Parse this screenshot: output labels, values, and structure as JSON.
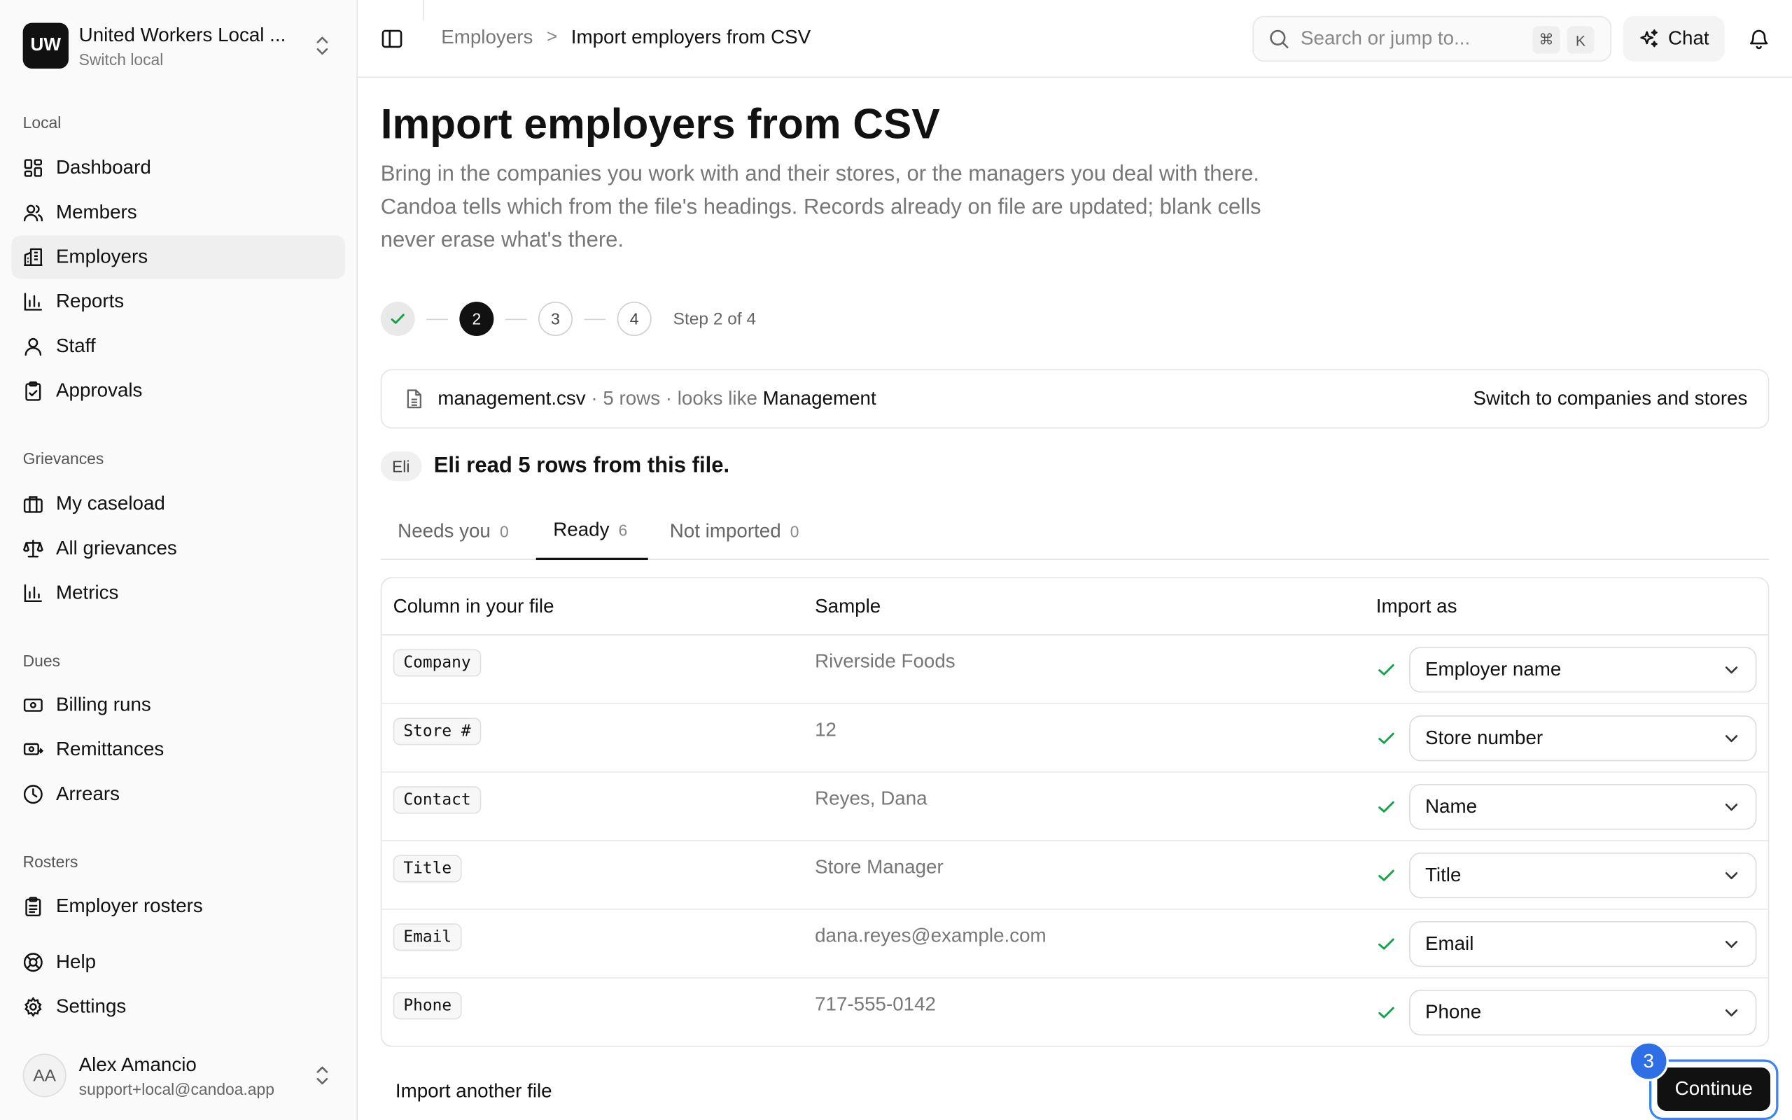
{
  "org": {
    "initials": "UW",
    "name": "United Workers Local ...",
    "subtitle": "Switch local"
  },
  "sidebar": {
    "sections": {
      "local": "Local",
      "grievances": "Grievances",
      "dues": "Dues",
      "rosters": "Rosters"
    },
    "items": {
      "dashboard": "Dashboard",
      "members": "Members",
      "employers": "Employers",
      "reports": "Reports",
      "staff": "Staff",
      "approvals": "Approvals",
      "my_caseload": "My caseload",
      "all_grievances": "All grievances",
      "metrics": "Metrics",
      "billing_runs": "Billing runs",
      "remittances": "Remittances",
      "arrears": "Arrears",
      "employer_rosters": "Employer rosters",
      "help": "Help",
      "settings": "Settings"
    },
    "active_item": "employers"
  },
  "user": {
    "initials": "AA",
    "name": "Alex Amancio",
    "email": "support+local@candoa.app"
  },
  "topbar": {
    "breadcrumb_parent": "Employers",
    "breadcrumb_separator": ">",
    "breadcrumb_current": "Import employers from CSV",
    "search_placeholder": "Search or jump to...",
    "shortcut_mod": "⌘",
    "shortcut_key": "K",
    "chat_label": "Chat"
  },
  "page": {
    "title": "Import employers from CSV",
    "description": "Bring in the companies you work with and their stores, or the managers you deal with there. Candoa tells which from the file's headings. Records already on file are updated; blank cells never erase what's there."
  },
  "stepper": {
    "steps": [
      "1",
      "2",
      "3",
      "4"
    ],
    "current": 2,
    "label": "Step 2 of 4"
  },
  "file": {
    "name": "management.csv",
    "meta": " · 5 rows · looks like ",
    "kind": "Management",
    "switch_label": "Switch to companies and stores"
  },
  "assistant": {
    "badge": "Eli",
    "message": "Eli read 5 rows from this file."
  },
  "tabs": [
    {
      "label": "Needs you",
      "count": "0"
    },
    {
      "label": "Ready",
      "count": "6"
    },
    {
      "label": "Not imported",
      "count": "0"
    }
  ],
  "active_tab": "Ready",
  "table": {
    "headers": {
      "column": "Column in your file",
      "sample": "Sample",
      "import_as": "Import as"
    },
    "rows": [
      {
        "column": "Company",
        "sample": "Riverside Foods",
        "import_as": "Employer name"
      },
      {
        "column": "Store #",
        "sample": "12",
        "import_as": "Store number"
      },
      {
        "column": "Contact",
        "sample": "Reyes, Dana",
        "import_as": "Name"
      },
      {
        "column": "Title",
        "sample": "Store Manager",
        "import_as": "Title"
      },
      {
        "column": "Email",
        "sample": "dana.reyes@example.com",
        "import_as": "Email"
      },
      {
        "column": "Phone",
        "sample": "717-555-0142",
        "import_as": "Phone"
      }
    ]
  },
  "footer": {
    "another_label": "Import another file",
    "continue_label": "Continue",
    "marker": "3"
  },
  "colors": {
    "accent_dark": "#111111",
    "success": "#16a34a",
    "focus_ring": "#3b82f6",
    "marker": "#2f6fe6"
  }
}
